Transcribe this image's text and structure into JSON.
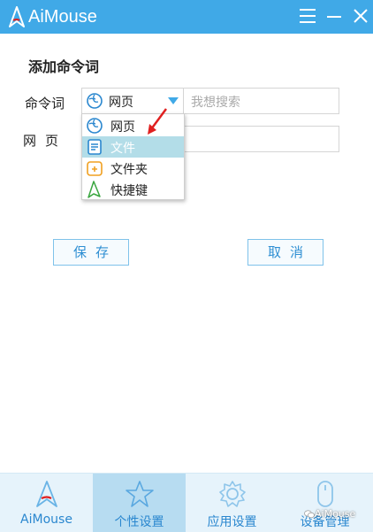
{
  "app": {
    "title": "AiMouse"
  },
  "colors": {
    "accent": "#40a9e7",
    "selected_row": "#b3dde8",
    "nav_bg": "#e6f3fb",
    "nav_active": "#b7dcf1",
    "arrow": "#e02020"
  },
  "form": {
    "heading": "添加命令词",
    "command_label": "命令词",
    "web_label": "网页",
    "type_select": {
      "selected": "网页",
      "icon": "browser-icon"
    },
    "command_input": {
      "placeholder": "我想搜索",
      "value": ""
    },
    "web_input": {
      "value": ""
    }
  },
  "dropdown": {
    "items": [
      {
        "label": "网页",
        "icon": "browser-icon"
      },
      {
        "label": "文件",
        "icon": "file-icon",
        "selected": true
      },
      {
        "label": "文件夹",
        "icon": "folder-icon"
      },
      {
        "label": "快捷键",
        "icon": "shortcut-icon"
      }
    ]
  },
  "buttons": {
    "save": "保存",
    "cancel": "取消"
  },
  "nav": {
    "items": [
      {
        "label": "AiMouse",
        "icon": "aimouse-logo-icon"
      },
      {
        "label": "个性设置",
        "icon": "star-icon",
        "active": true
      },
      {
        "label": "应用设置",
        "icon": "gear-icon"
      },
      {
        "label": "设备管理",
        "icon": "mouse-icon"
      }
    ]
  },
  "watermark": "AiMouse"
}
